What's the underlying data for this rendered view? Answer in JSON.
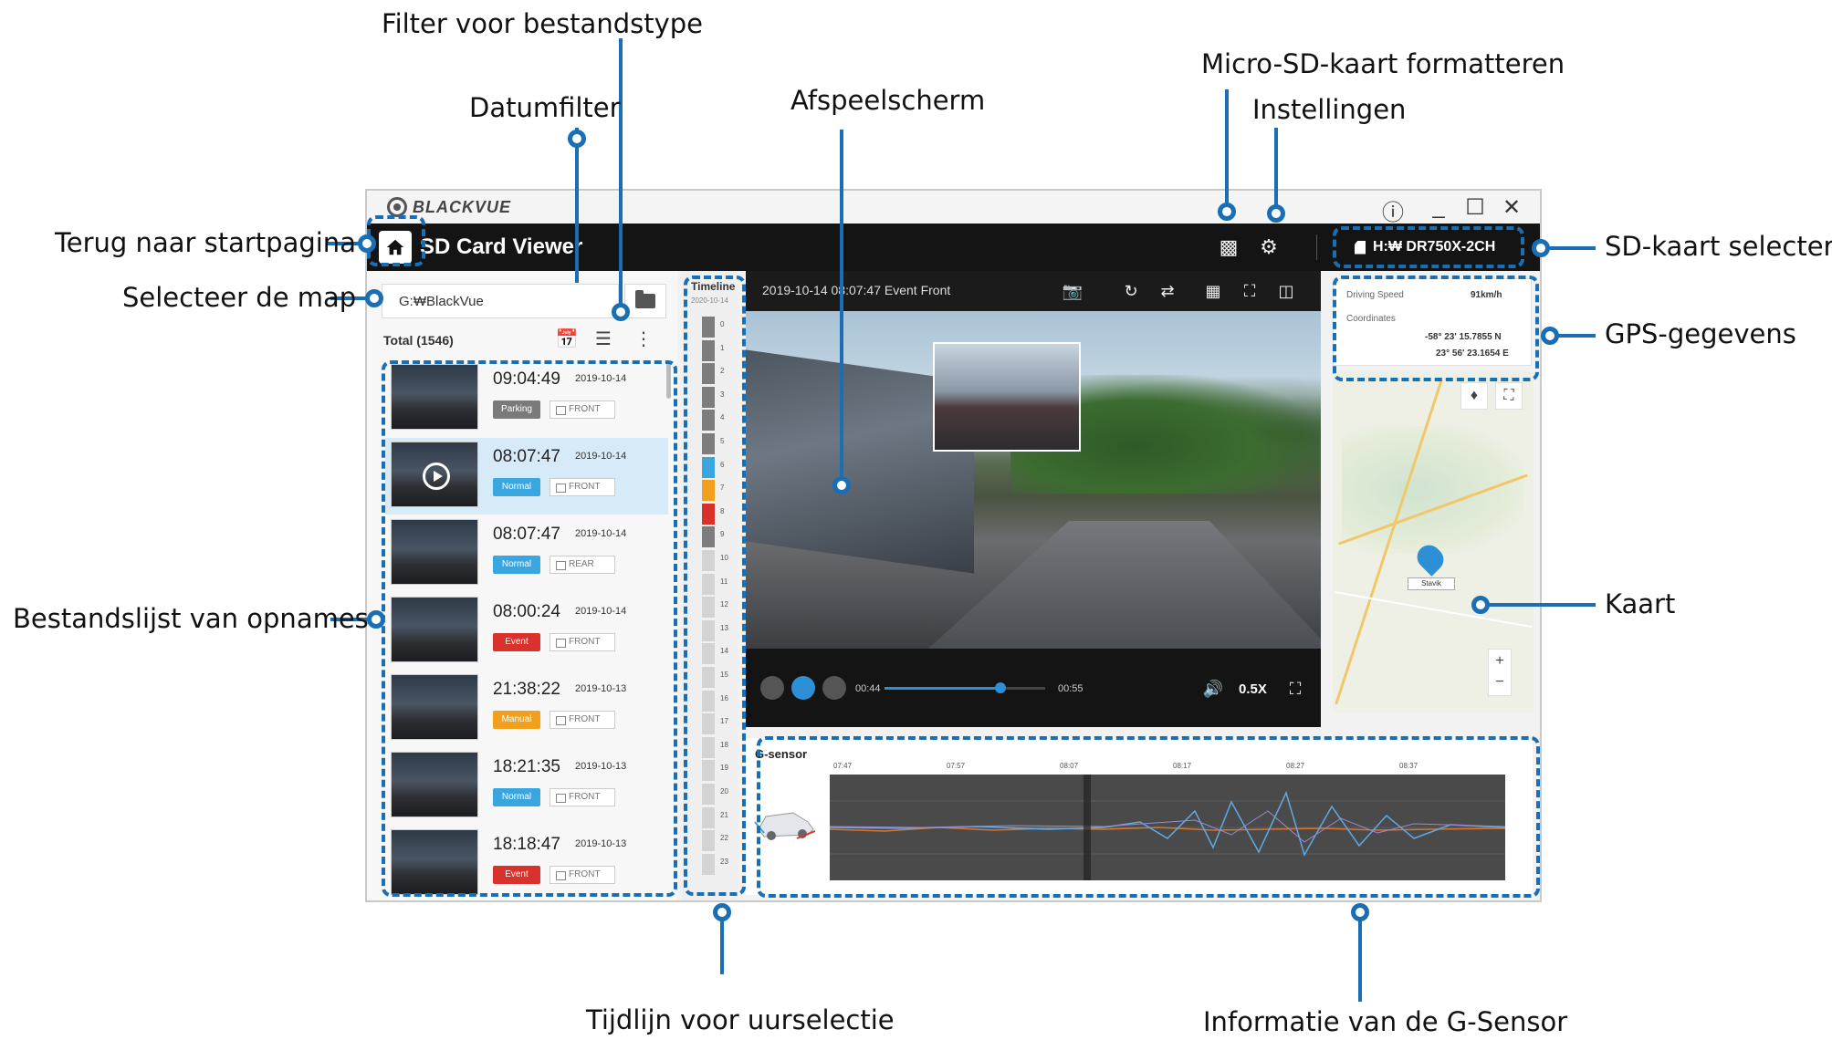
{
  "callouts": {
    "filter_type": "Filter voor bestandstype",
    "date_filter": "Datumfilter",
    "player": "Afspeelscherm",
    "format_sd": "Micro-SD-kaart formatteren",
    "settings": "Instellingen",
    "home": "Terug naar startpagina",
    "select_folder": "Selecteer de map",
    "sd_select": "SD-kaart selecteren",
    "gps": "GPS-gegevens",
    "file_list": "Bestandslijst van opnames",
    "map": "Kaart",
    "timeline": "Tijdlijn voor uurselectie",
    "gsensor": "Informatie van de G-Sensor"
  },
  "app": {
    "brand": "BLACKVUE",
    "title": "SD Card Viewer",
    "sd_card": "H:₩ DR750X-2CH",
    "folder_path": "G:₩BlackVue",
    "total": "Total (1546)"
  },
  "files": [
    {
      "time": "09:04:49",
      "date": "2019-10-14",
      "type": "Parking",
      "camera": "FRONT",
      "color": "#7a7a7a",
      "selected": false
    },
    {
      "time": "08:07:47",
      "date": "2019-10-14",
      "type": "Normal",
      "camera": "FRONT",
      "color": "#39a6e0",
      "selected": true
    },
    {
      "time": "08:07:47",
      "date": "2019-10-14",
      "type": "Normal",
      "camera": "REAR",
      "color": "#39a6e0",
      "selected": false
    },
    {
      "time": "08:00:24",
      "date": "2019-10-14",
      "type": "Event",
      "camera": "FRONT",
      "color": "#d9322c",
      "selected": false
    },
    {
      "time": "21:38:22",
      "date": "2019-10-13",
      "type": "Manual",
      "camera": "FRONT",
      "color": "#f0a01c",
      "selected": false
    },
    {
      "time": "18:21:35",
      "date": "2019-10-13",
      "type": "Normal",
      "camera": "FRONT",
      "color": "#39a6e0",
      "selected": false
    },
    {
      "time": "18:18:47",
      "date": "2019-10-13",
      "type": "Event",
      "camera": "FRONT",
      "color": "#d9322c",
      "selected": false
    }
  ],
  "timeline": {
    "title": "Timeline",
    "date": "2020-10-14",
    "hours": [
      "0",
      "1",
      "2",
      "3",
      "4",
      "5",
      "6",
      "7",
      "8",
      "9",
      "10",
      "11",
      "12",
      "13",
      "14",
      "15",
      "16",
      "17",
      "18",
      "19",
      "20",
      "21",
      "22",
      "23"
    ],
    "colors": [
      "#7d7d7d",
      "#7d7d7d",
      "#7d7d7d",
      "#7d7d7d",
      "#7d7d7d",
      "#7d7d7d",
      "#39a6e0",
      "#f0a01c",
      "#d9322c",
      "#7d7d7d",
      "#d3d3d3",
      "#d3d3d3",
      "#d3d3d3",
      "#d3d3d3",
      "#d3d3d3",
      "#d3d3d3",
      "#d3d3d3",
      "#d3d3d3",
      "#d3d3d3",
      "#d3d3d3",
      "#d3d3d3",
      "#d3d3d3",
      "#d3d3d3",
      "#d3d3d3"
    ]
  },
  "player": {
    "title": "2019-10-14 08:07:47 Event Front",
    "current_time": "00:44",
    "end_time": "00:55",
    "progress": 0.72,
    "speed": "0.5X"
  },
  "gps": {
    "speed_label": "Driving Speed",
    "speed_value": "91km/h",
    "coords_label": "Coordinates",
    "lat": "-58° 23' 15.7855 N",
    "lon": "23° 56' 23.1654 E"
  },
  "map": {
    "marker_label": "Stavik"
  },
  "gsensor": {
    "title": "G-sensor",
    "ticks": [
      "07:47",
      "07:57",
      "08:07",
      "08:17",
      "08:27",
      "08:37"
    ]
  }
}
